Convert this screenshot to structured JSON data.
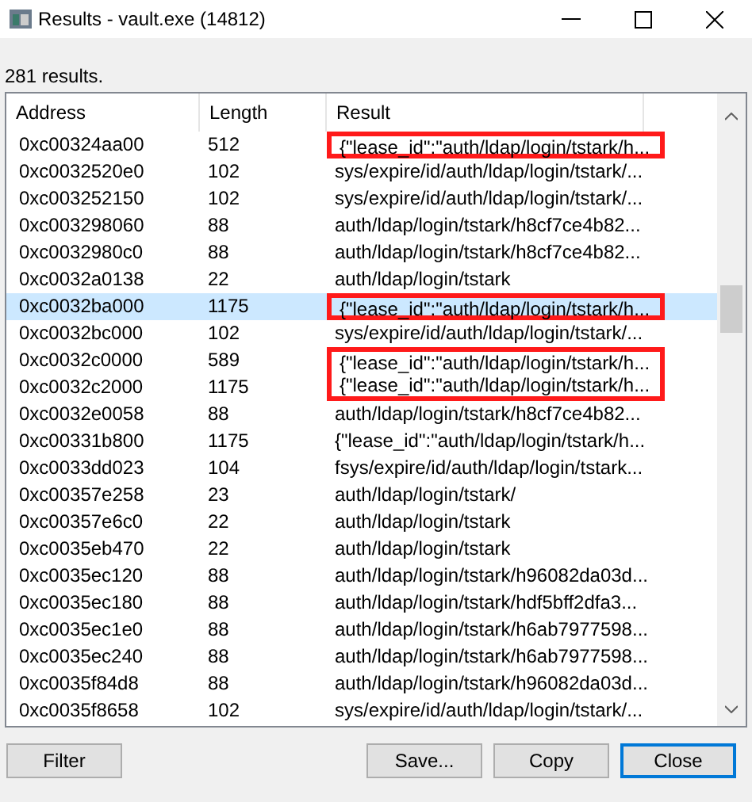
{
  "window": {
    "title": "Results - vault.exe (14812)"
  },
  "summary": "281 results.",
  "table": {
    "columns": [
      "Address",
      "Length",
      "Result"
    ],
    "rows": [
      {
        "address": "0xc00324aa00",
        "length": "512",
        "result": "{\"lease_id\":\"auth/ldap/login/tstark/h...",
        "selected": false,
        "highlighted": true
      },
      {
        "address": "0xc0032520e0",
        "length": "102",
        "result": "sys/expire/id/auth/ldap/login/tstark/...",
        "selected": false,
        "highlighted": false
      },
      {
        "address": "0xc003252150",
        "length": "102",
        "result": "sys/expire/id/auth/ldap/login/tstark/...",
        "selected": false,
        "highlighted": false
      },
      {
        "address": "0xc003298060",
        "length": "88",
        "result": "auth/ldap/login/tstark/h8cf7ce4b82...",
        "selected": false,
        "highlighted": false
      },
      {
        "address": "0xc0032980c0",
        "length": "88",
        "result": "auth/ldap/login/tstark/h8cf7ce4b82...",
        "selected": false,
        "highlighted": false
      },
      {
        "address": "0xc0032a0138",
        "length": "22",
        "result": "auth/ldap/login/tstark",
        "selected": false,
        "highlighted": false
      },
      {
        "address": "0xc0032ba000",
        "length": "1175",
        "result": "{\"lease_id\":\"auth/ldap/login/tstark/h...",
        "selected": true,
        "highlighted": true
      },
      {
        "address": "0xc0032bc000",
        "length": "102",
        "result": "sys/expire/id/auth/ldap/login/tstark/...",
        "selected": false,
        "highlighted": false
      },
      {
        "address": "0xc0032c0000",
        "length": "589",
        "result": "{\"lease_id\":\"auth/ldap/login/tstark/h...",
        "selected": false,
        "highlighted": true
      },
      {
        "address": "0xc0032c2000",
        "length": "1175",
        "result": "{\"lease_id\":\"auth/ldap/login/tstark/h...",
        "selected": false,
        "highlighted": true
      },
      {
        "address": "0xc0032e0058",
        "length": "88",
        "result": "auth/ldap/login/tstark/h8cf7ce4b82...",
        "selected": false,
        "highlighted": false
      },
      {
        "address": "0xc00331b800",
        "length": "1175",
        "result": "{\"lease_id\":\"auth/ldap/login/tstark/h...",
        "selected": false,
        "highlighted": false
      },
      {
        "address": "0xc0033dd023",
        "length": "104",
        "result": "fsys/expire/id/auth/ldap/login/tstark...",
        "selected": false,
        "highlighted": false
      },
      {
        "address": "0xc00357e258",
        "length": "23",
        "result": "auth/ldap/login/tstark/",
        "selected": false,
        "highlighted": false
      },
      {
        "address": "0xc00357e6c0",
        "length": "22",
        "result": "auth/ldap/login/tstark",
        "selected": false,
        "highlighted": false
      },
      {
        "address": "0xc0035eb470",
        "length": "22",
        "result": "auth/ldap/login/tstark",
        "selected": false,
        "highlighted": false
      },
      {
        "address": "0xc0035ec120",
        "length": "88",
        "result": "auth/ldap/login/tstark/h96082da03d...",
        "selected": false,
        "highlighted": false
      },
      {
        "address": "0xc0035ec180",
        "length": "88",
        "result": "auth/ldap/login/tstark/hdf5bff2dfa3...",
        "selected": false,
        "highlighted": false
      },
      {
        "address": "0xc0035ec1e0",
        "length": "88",
        "result": "auth/ldap/login/tstark/h6ab7977598...",
        "selected": false,
        "highlighted": false
      },
      {
        "address": "0xc0035ec240",
        "length": "88",
        "result": "auth/ldap/login/tstark/h6ab7977598...",
        "selected": false,
        "highlighted": false
      },
      {
        "address": "0xc0035f84d8",
        "length": "88",
        "result": "auth/ldap/login/tstark/h96082da03d...",
        "selected": false,
        "highlighted": false
      },
      {
        "address": "0xc0035f8658",
        "length": "102",
        "result": "sys/expire/id/auth/ldap/login/tstark/...",
        "selected": false,
        "highlighted": false
      }
    ]
  },
  "buttons": [
    {
      "label": "Filter",
      "default": false
    },
    {
      "label": "Save...",
      "default": false
    },
    {
      "label": "Copy",
      "default": false
    },
    {
      "label": "Close",
      "default": true
    }
  ]
}
